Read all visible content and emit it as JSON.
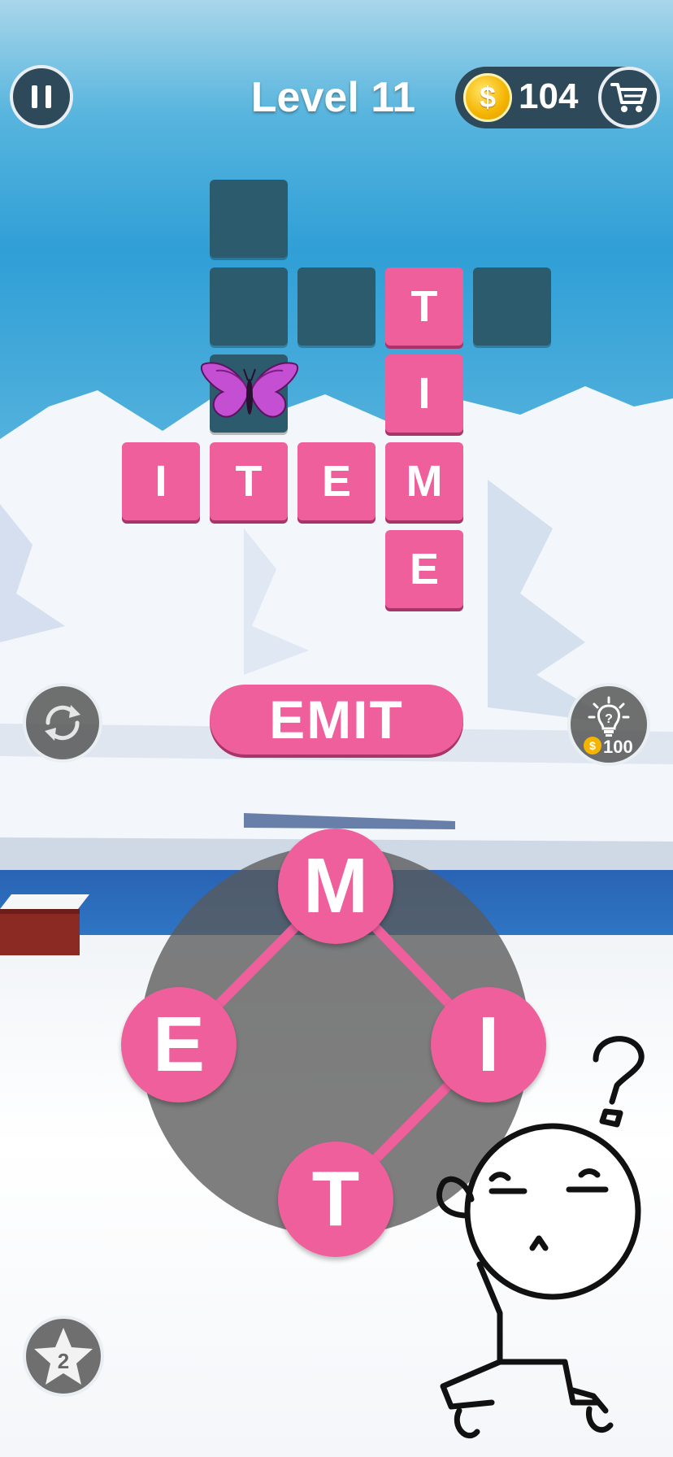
{
  "header": {
    "pause_icon": "pause-icon",
    "level_title": "Level 11",
    "coins": "104",
    "coin_symbol": "$",
    "cart_icon": "shopping-cart-icon"
  },
  "board": {
    "words": [
      "ITEM",
      "TIME"
    ],
    "tiles": [
      {
        "id": "r0c1",
        "letter": ""
      },
      {
        "id": "r1c1",
        "letter": ""
      },
      {
        "id": "r1c2",
        "letter": ""
      },
      {
        "id": "r1c3",
        "letter": "T"
      },
      {
        "id": "r1c4",
        "letter": ""
      },
      {
        "id": "r2c1",
        "letter": ""
      },
      {
        "id": "r2c3",
        "letter": "I"
      },
      {
        "id": "r3c0",
        "letter": "I"
      },
      {
        "id": "r3c1",
        "letter": "T"
      },
      {
        "id": "r3c2",
        "letter": "E"
      },
      {
        "id": "r3c3",
        "letter": "M"
      },
      {
        "id": "r4c3",
        "letter": "E"
      }
    ],
    "decoration": "butterfly-icon"
  },
  "current_word": "EMIT",
  "actions": {
    "shuffle_icon": "shuffle-icon",
    "hint_icon": "lightbulb-hint-icon",
    "hint_coin_symbol": "$",
    "hint_cost": "100",
    "star_icon": "star-icon",
    "star_count": "2"
  },
  "wheel": {
    "letters": [
      "M",
      "E",
      "I",
      "T"
    ],
    "connected_path": [
      "E",
      "M",
      "I",
      "T"
    ]
  },
  "mascot": "thinking-stickman-icon",
  "colors": {
    "tile_filled": "#ee5f9c",
    "tile_empty": "#2b5b6c",
    "button_dark": "#2e4a5a",
    "coin_gold": "#f4b400"
  }
}
